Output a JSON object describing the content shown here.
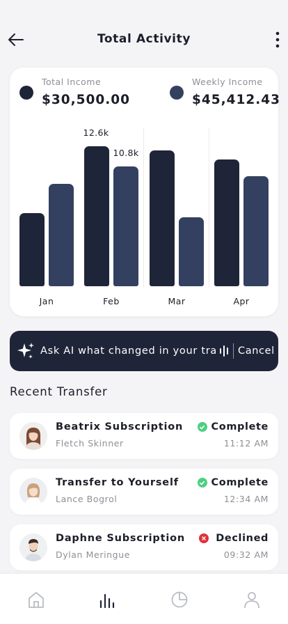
{
  "header": {
    "title": "Total Activity",
    "back_icon": "arrow-left-icon",
    "more_icon": "more-vertical-icon"
  },
  "colors": {
    "total_income": "#1f2538",
    "weekly_income": "#34405f",
    "complete": "#4ccf83",
    "declined": "#e0313a",
    "ai_bar": "#1f2539"
  },
  "legend": {
    "total_label": "Total Income",
    "total_value": "$30,500.00",
    "weekly_label": "Weekly Income",
    "weekly_value": "$45,412.43"
  },
  "chart_data": {
    "type": "bar",
    "categories": [
      "Jan",
      "Feb",
      "Mar",
      "Apr"
    ],
    "series": [
      {
        "name": "Total Income",
        "values": [
          6.6,
          12.6,
          12.2,
          11.4
        ]
      },
      {
        "name": "Weekly Income",
        "values": [
          9.2,
          10.8,
          6.2,
          9.9
        ]
      }
    ],
    "data_labels": [
      {
        "category": "Feb",
        "series": "Total Income",
        "text": "12.6k"
      },
      {
        "category": "Feb",
        "series": "Weekly Income",
        "text": "10.8k"
      }
    ],
    "ylim": [
      0,
      14.5
    ],
    "grid": false,
    "legend_position": "top"
  },
  "ai": {
    "prompt": "Ask AI what changed in your tra...",
    "cancel_label": "Cancel",
    "spark_icon": "sparkles-icon",
    "wave_icon": "voice-wave-icon"
  },
  "recent": {
    "title": "Recent Transfer",
    "items": [
      {
        "title": "Beatrix Subscription",
        "subtitle": "Fletch Skinner",
        "status": "Complete",
        "status_kind": "complete",
        "time": "11:12 AM"
      },
      {
        "title": "Transfer to Yourself",
        "subtitle": "Lance Bogrol",
        "status": "Complete",
        "status_kind": "complete",
        "time": "12:34 AM"
      },
      {
        "title": "Daphne Subscription",
        "subtitle": "Dylan Meringue",
        "status": "Declined",
        "status_kind": "declined",
        "time": "09:32 AM"
      }
    ]
  },
  "tabbar": {
    "items": [
      {
        "icon": "home-icon",
        "active": false
      },
      {
        "icon": "bar-chart-icon",
        "active": true
      },
      {
        "icon": "pie-chart-icon",
        "active": false
      },
      {
        "icon": "profile-icon",
        "active": false
      }
    ]
  }
}
